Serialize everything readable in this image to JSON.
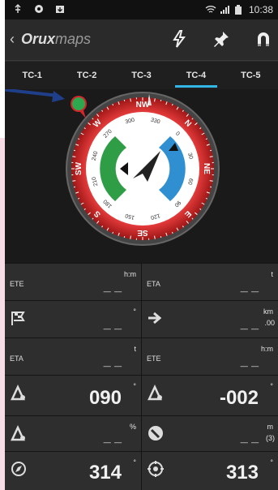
{
  "statusbar": {
    "time": "10:38"
  },
  "app": {
    "brand_bold": "Oruxmaps",
    "brand_part1": "Orux",
    "brand_part2": "maps",
    "back": "‹"
  },
  "tabs": [
    "TC-1",
    "TC-2",
    "TC-3",
    "TC-4",
    "TC-5"
  ],
  "active_tab": "TC-4",
  "compass": {
    "cardinals": [
      "NW",
      "N",
      "NE",
      "E",
      "SE",
      "S",
      "SW",
      "W"
    ],
    "inner_ticks": [
      "270",
      "300",
      "330",
      "0",
      "30",
      "60",
      "90",
      "120",
      "150",
      "180",
      "210",
      "240"
    ],
    "inner_ticks_2": [
      "330",
      "300",
      "270",
      "240",
      "210",
      "180"
    ],
    "inner_ticks_3": [
      "30",
      "60",
      "90",
      "120",
      "150"
    ],
    "colors": {
      "bezel": "#d4252a",
      "left_arc": "#2e9d45",
      "right_arc": "#2f8fd1",
      "face": "#f2f2f2",
      "needle": "#222222"
    }
  },
  "cells": {
    "r1c1": {
      "label": "ETE",
      "value": "_ _",
      "unit": "h:m"
    },
    "r1c2": {
      "label": "ETA",
      "value": "_ _",
      "unit": "t"
    },
    "r2c1": {
      "label": "",
      "value": "_ _",
      "unit": "°"
    },
    "r2c2": {
      "label": "",
      "value": "_ _",
      "unit": "km",
      "sub": ".00"
    },
    "r3c1": {
      "label": "ETA",
      "value": "_ _",
      "unit": "t"
    },
    "r3c2": {
      "label": "ETE",
      "value": "_ _",
      "unit": "h:m"
    },
    "r4c1": {
      "label": "",
      "value": "090",
      "unit": "°"
    },
    "r4c2": {
      "label": "",
      "value": "-002",
      "unit": "°"
    },
    "r5c1": {
      "label": "",
      "value": "_ _",
      "unit": "%"
    },
    "r5c2": {
      "label": "",
      "value": "_ _",
      "unit": "m",
      "sub": "(3)"
    },
    "r6c1": {
      "label": "",
      "value": "314",
      "unit": "°"
    },
    "r6c2": {
      "label": "",
      "value": "313",
      "unit": "°"
    }
  }
}
